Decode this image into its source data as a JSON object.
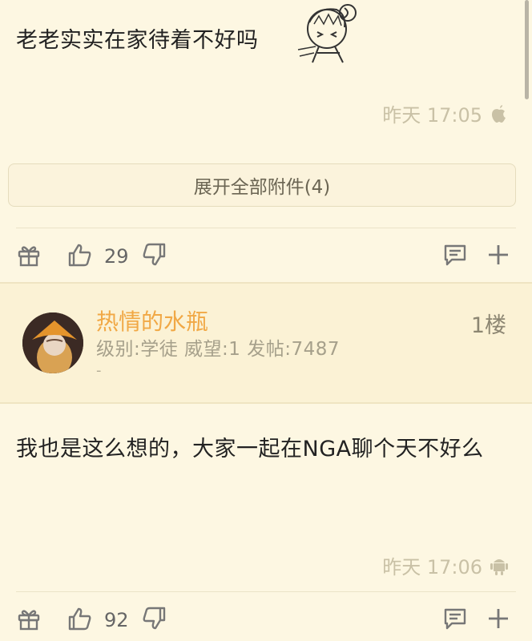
{
  "post1": {
    "text": "老老实实在家待着不好吗",
    "time": "昨天 17:05",
    "platform_icon": "apple-icon",
    "attachments_label": "展开全部附件(4)",
    "likes": "29"
  },
  "author": {
    "name": "热情的水瓶",
    "info": "级别:学徒 威望:1 发帖:7487",
    "extra": "-",
    "floor": "1楼"
  },
  "post2": {
    "text": "我也是这么想的，大家一起在NGA聊个天不好么",
    "time": "昨天 17:06",
    "platform_icon": "android-icon",
    "likes": "92"
  },
  "colors": {
    "background": "#fdf7e2",
    "author_name": "#f1a845",
    "meta": "#c9c1a6"
  }
}
